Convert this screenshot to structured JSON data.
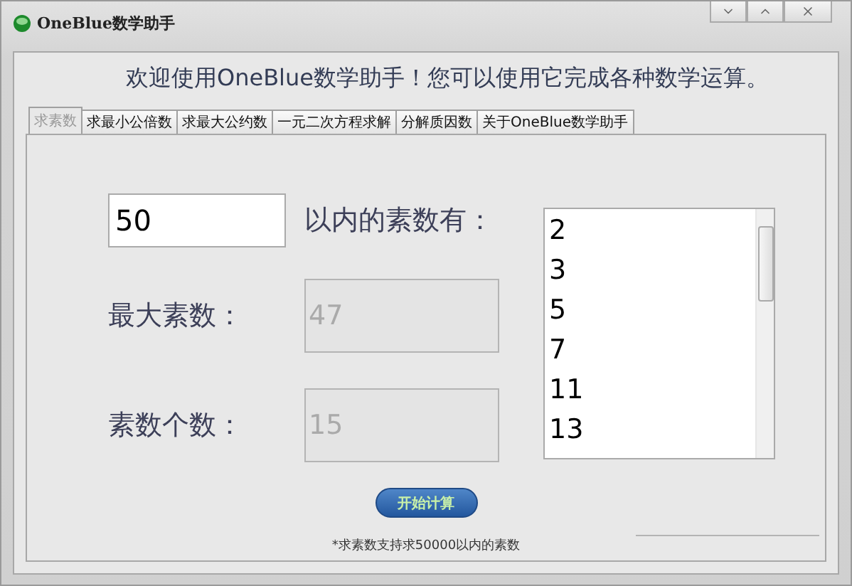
{
  "window": {
    "title": "OneBlue数学助手"
  },
  "heading": "欢迎使用OneBlue数学助手！您可以使用它完成各种数学运算。",
  "tabs": [
    {
      "label": "求素数",
      "selected": true
    },
    {
      "label": "求最小公倍数",
      "selected": false
    },
    {
      "label": "求最大公约数",
      "selected": false
    },
    {
      "label": "一元二次方程求解",
      "selected": false
    },
    {
      "label": "分解质因数",
      "selected": false
    },
    {
      "label": "关于OneBlue数学助手",
      "selected": false
    }
  ],
  "limit_input": {
    "value": "50"
  },
  "limit_label": "以内的素数有：",
  "results": [
    {
      "label": "最大素数：",
      "value": "47",
      "disabled": true
    },
    {
      "label": "素数个数：",
      "value": "15",
      "disabled": true
    }
  ],
  "primes": [
    "2",
    "3",
    "5",
    "7",
    "11",
    "13"
  ],
  "start_button": "开始计算",
  "note": "*求素数支持求50000以内的素数"
}
